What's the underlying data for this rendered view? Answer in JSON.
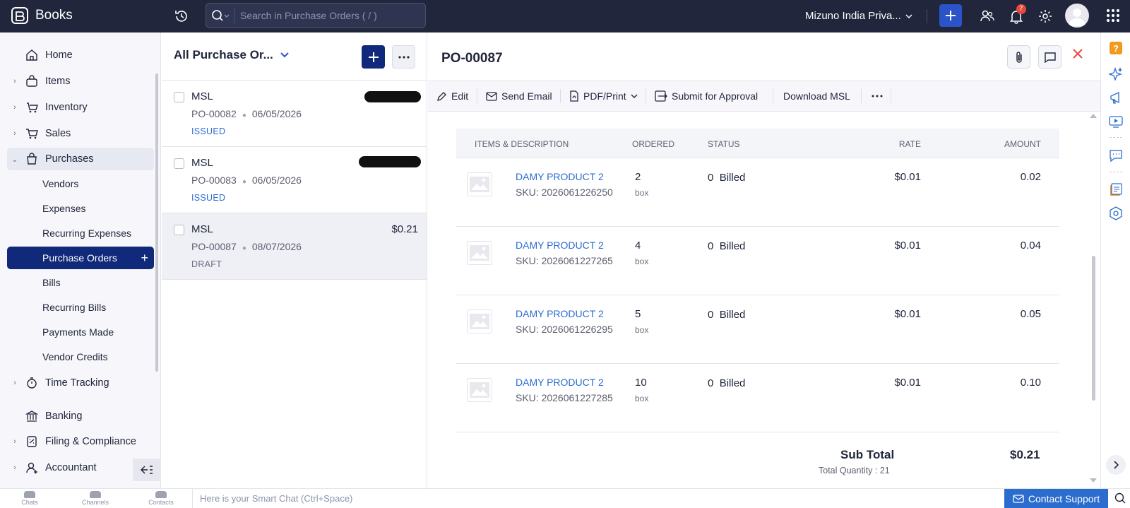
{
  "app": {
    "name": "Books"
  },
  "topbar": {
    "search_placeholder": "Search in Purchase Orders ( / )",
    "org_name": "Mizuno India Priva...",
    "notification_count": "7"
  },
  "sidebar": {
    "items": [
      {
        "label": "Home"
      },
      {
        "label": "Items"
      },
      {
        "label": "Inventory"
      },
      {
        "label": "Sales"
      },
      {
        "label": "Purchases"
      },
      {
        "label": "Time Tracking"
      },
      {
        "label": "Banking"
      },
      {
        "label": "Filing & Compliance"
      },
      {
        "label": "Accountant"
      }
    ],
    "purchases_sub": [
      {
        "label": "Vendors"
      },
      {
        "label": "Expenses"
      },
      {
        "label": "Recurring Expenses"
      },
      {
        "label": "Purchase Orders"
      },
      {
        "label": "Bills"
      },
      {
        "label": "Recurring Bills"
      },
      {
        "label": "Payments Made"
      },
      {
        "label": "Vendor Credits"
      }
    ]
  },
  "list": {
    "title": "All Purchase Or...",
    "rows": [
      {
        "vendor": "MSL",
        "number": "PO-00082",
        "date": "06/05/2026",
        "status": "ISSUED",
        "status_color": "#2b6ccf",
        "amount": ""
      },
      {
        "vendor": "MSL",
        "number": "PO-00083",
        "date": "06/05/2026",
        "status": "ISSUED",
        "status_color": "#2b6ccf",
        "amount": ""
      },
      {
        "vendor": "MSL",
        "number": "PO-00087",
        "date": "08/07/2026",
        "status": "DRAFT",
        "status_color": "#6b6f80",
        "amount": "$0.21"
      }
    ]
  },
  "detail": {
    "title": "PO-00087",
    "toolbar": {
      "edit": "Edit",
      "send_email": "Send Email",
      "pdf_print": "PDF/Print",
      "submit": "Submit for Approval",
      "download": "Download MSL"
    },
    "table": {
      "headers": {
        "items": "ITEMS & DESCRIPTION",
        "ordered": "ORDERED",
        "status": "STATUS",
        "rate": "RATE",
        "amount": "AMOUNT"
      },
      "rows": [
        {
          "name": "DAMY PRODUCT 2",
          "sku": "SKU: 2026061226250",
          "qty": "2",
          "unit": "box",
          "billed_count": "0",
          "billed_label": "Billed",
          "rate": "$0.01",
          "amount": "0.02"
        },
        {
          "name": "DAMY PRODUCT 2",
          "sku": "SKU: 2026061227265",
          "qty": "4",
          "unit": "box",
          "billed_count": "0",
          "billed_label": "Billed",
          "rate": "$0.01",
          "amount": "0.04"
        },
        {
          "name": "DAMY PRODUCT 2",
          "sku": "SKU: 2026061226295",
          "qty": "5",
          "unit": "box",
          "billed_count": "0",
          "billed_label": "Billed",
          "rate": "$0.01",
          "amount": "0.05"
        },
        {
          "name": "DAMY PRODUCT 2",
          "sku": "SKU: 2026061227285",
          "qty": "10",
          "unit": "box",
          "billed_count": "0",
          "billed_label": "Billed",
          "rate": "$0.01",
          "amount": "0.10"
        }
      ]
    },
    "subtotal_label": "Sub Total",
    "subtotal_value": "$0.21",
    "total_quantity": "Total Quantity : 21"
  },
  "bottombar": {
    "chats": "Chats",
    "channels": "Channels",
    "contacts": "Contacts",
    "chat_placeholder": "Here is your Smart Chat (Ctrl+Space)",
    "contact_support": "Contact Support"
  },
  "colors": {
    "topbar_bg": "#21263c",
    "accent": "#10297a",
    "link": "#2b6ccf",
    "close": "#e5483e"
  }
}
